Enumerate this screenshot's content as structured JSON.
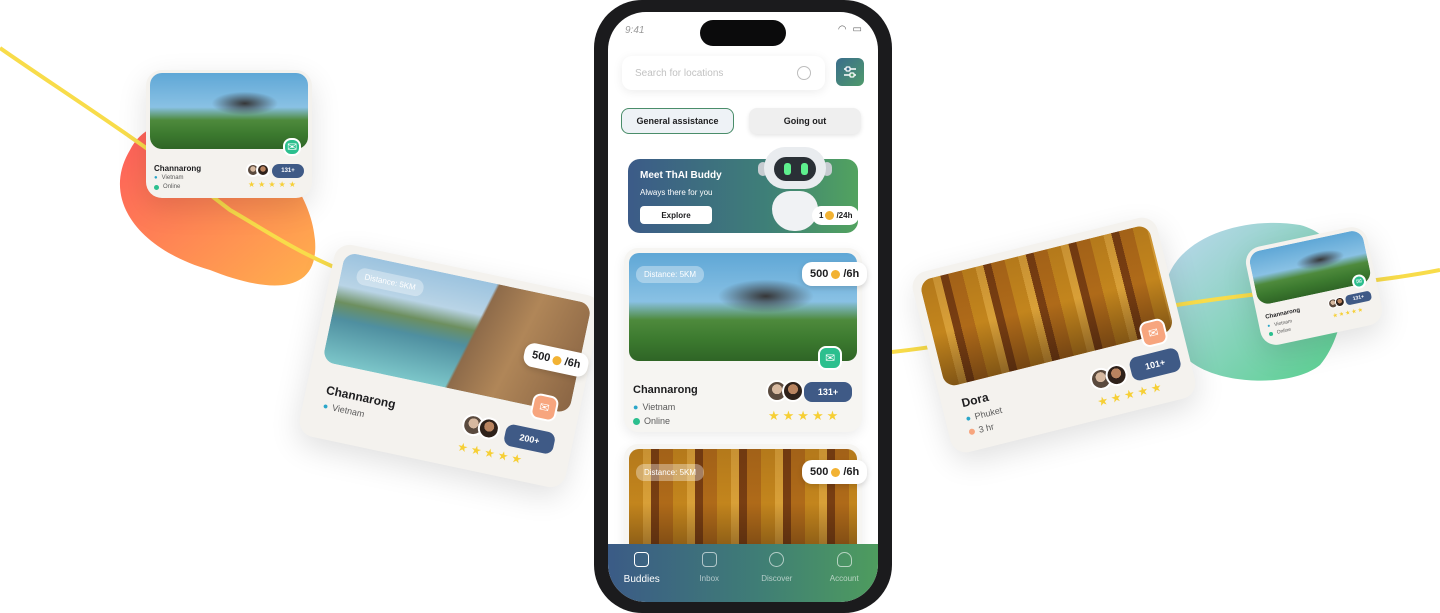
{
  "colors": {
    "accent_blue": "#3f5a86",
    "accent_green": "#4e9c5e",
    "star": "#f6cf35",
    "yellow_line": "#f8dc4a"
  },
  "phone": {
    "status_time": "9:41",
    "search": {
      "placeholder": "Search for locations",
      "icon": "search-icon"
    },
    "filter_icon": "filter-sliders-icon",
    "tabs": [
      {
        "label": "General assistance",
        "active": true
      },
      {
        "label": "Going out",
        "active": false
      }
    ],
    "banner": {
      "title": "Meet ThAI Buddy",
      "subtitle": "Always there for you",
      "button": "Explore",
      "price_amount": "1",
      "price_unit": "/24h"
    },
    "cards": [
      {
        "distance": "Distance: 5KM",
        "price_amount": "500",
        "price_unit": "/6h",
        "name": "Channarong",
        "location": "Vietnam",
        "status": "Online",
        "count": "131+",
        "rating": 5
      },
      {
        "distance": "Distance: 5KM",
        "price_amount": "500",
        "price_unit": "/6h"
      }
    ],
    "nav": [
      {
        "label": "Buddies",
        "icon": "buddies-icon",
        "active": true
      },
      {
        "label": "Inbox",
        "icon": "inbox-icon",
        "active": false
      },
      {
        "label": "Discover",
        "icon": "compass-icon",
        "active": false
      },
      {
        "label": "Account",
        "icon": "user-icon",
        "active": false
      }
    ]
  },
  "floating": {
    "top_left": {
      "name": "Channarong",
      "location": "Vietnam",
      "status": "Online",
      "count": "131+",
      "rating": 5
    },
    "mid_left": {
      "distance": "Distance: 5KM",
      "price_amount": "500",
      "price_unit": "/6h",
      "name": "Channarong",
      "location": "Vietnam",
      "count": "200+",
      "rating": 5
    },
    "mid_right": {
      "name": "Dora",
      "location": "Phuket",
      "duration": "3 hr",
      "count": "101+",
      "rating": 5
    },
    "far_right": {
      "name": "Channarong",
      "location": "Vietnam",
      "status": "Online",
      "count": "131+",
      "rating": 5
    }
  }
}
